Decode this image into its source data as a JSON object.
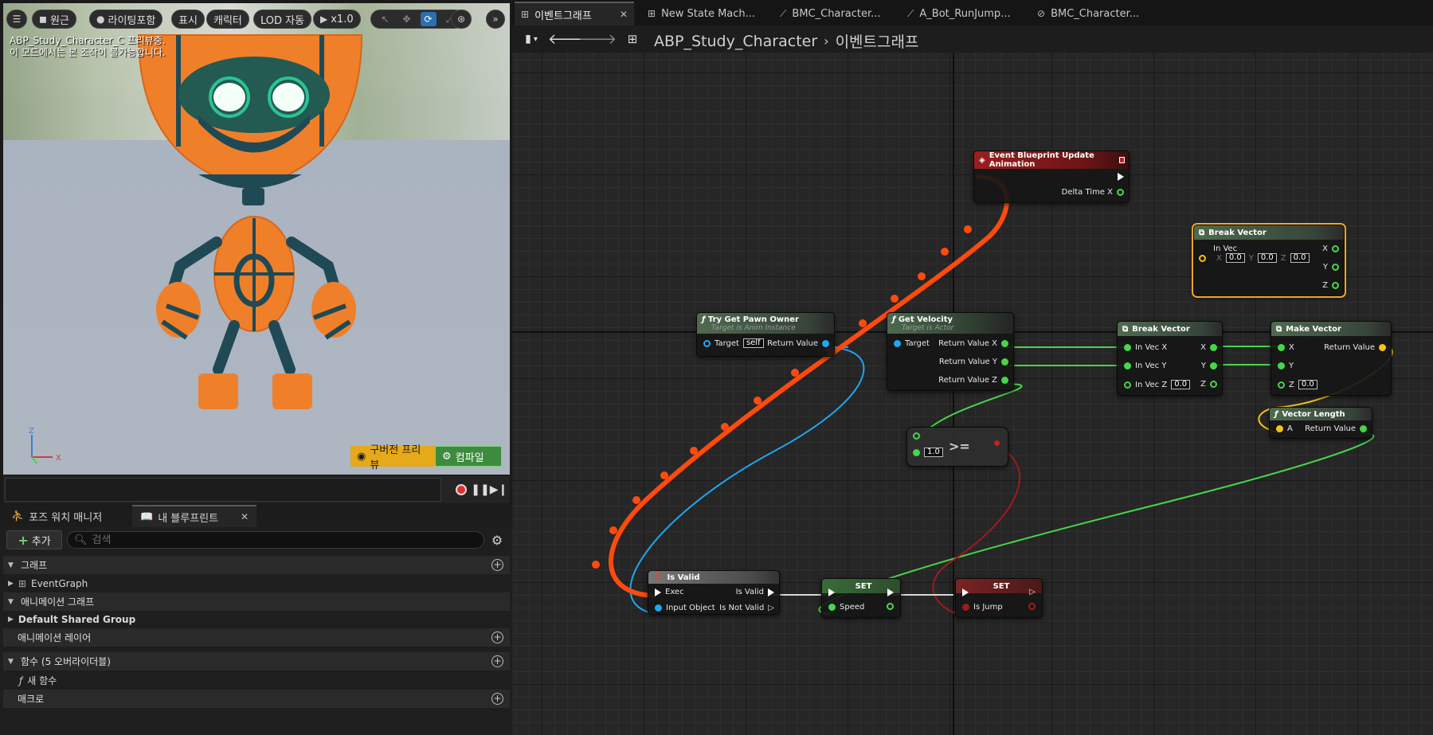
{
  "viewport": {
    "menu_icon": "hamburger-icon",
    "perspective_label": "원근",
    "lighting_label": "라이팅포함",
    "show_label": "표시",
    "character_label": "캐릭터",
    "lod_label": "LOD 자동",
    "play_speed_label": "x1.0",
    "info_line1": "ABP_Study_Character_C 프리뷰중.",
    "info_line2": "이 모드에서는 본 조작이 불가능합니다.",
    "axis_z": "Z",
    "axis_x": "X",
    "preview_button": "구버전 프리뷰",
    "compile_button": "컴파일",
    "colors": {
      "preview": "#e6a91a",
      "compile": "#3d8c3d"
    }
  },
  "left_panel": {
    "tab_pose": "포즈 워치 매니저",
    "tab_blueprint": "내 블루프린트",
    "add_label": "추가",
    "search_placeholder": "검색",
    "sections": {
      "graph": "그래프",
      "graph_item": "EventGraph",
      "anim_graph": "애니메이션 그래프",
      "anim_group": "Default Shared Group",
      "anim_layer": "애니메이션 레이어",
      "functions": "함수 (5 오버라이더블)",
      "new_function": "새 함수",
      "macro": "매크로"
    }
  },
  "editor": {
    "tabs": [
      {
        "label": "이벤트그래프",
        "icon": "graph-icon",
        "active": true
      },
      {
        "label": "New State Mach...",
        "icon": "state-machine-icon"
      },
      {
        "label": "BMC_Character...",
        "icon": "blend-icon"
      },
      {
        "label": "A_Bot_RunJump...",
        "icon": "blend-icon"
      },
      {
        "label": "BMC_Character...",
        "icon": "blend-space-icon"
      }
    ],
    "breadcrumb": {
      "asset": "ABP_Study_Character",
      "graph": "이벤트그래프"
    }
  },
  "nodes": {
    "event_update": {
      "title": "Event Blueprint Update Animation",
      "pin_delta": "Delta Time X"
    },
    "break_vector_sel": {
      "title": "Break Vector",
      "in_vec": "In Vec",
      "x_label": "X",
      "y_label": "Y",
      "z_label": "Z",
      "x": "0.0",
      "y": "0.0",
      "z": "0.0"
    },
    "try_get_pawn": {
      "title": "Try Get Pawn Owner",
      "subtitle": "Target is Anim Instance",
      "target": "Target",
      "target_val": "self",
      "ret": "Return Value"
    },
    "get_velocity": {
      "title": "Get Velocity",
      "subtitle": "Target is Actor",
      "target": "Target",
      "rx": "Return Value X",
      "ry": "Return Value Y",
      "rz": "Return Value Z"
    },
    "break_vector": {
      "title": "Break Vector",
      "in_x": "In Vec X",
      "in_y": "In Vec Y",
      "in_z": "In Vec Z",
      "in_z_val": "0.0",
      "x": "X",
      "y": "Y",
      "z": "Z"
    },
    "make_vector": {
      "title": "Make Vector",
      "x": "X",
      "y": "Y",
      "z": "Z",
      "z_val": "0.0",
      "ret": "Return Value"
    },
    "vector_length": {
      "title": "Vector Length",
      "a": "A",
      "ret": "Return Value"
    },
    "compare": {
      "op": ">=",
      "val": "1.0"
    },
    "is_valid": {
      "title": "Is Valid",
      "exec": "Exec",
      "input": "Input Object",
      "valid": "Is Valid",
      "not_valid": "Is Not Valid"
    },
    "set_speed": {
      "title": "SET",
      "pin": "Speed"
    },
    "set_jump": {
      "title": "SET",
      "pin": "Is Jump"
    }
  },
  "colors": {
    "exec_wire": "#ff4a0e",
    "object_pin": "#1ea7f0",
    "float_pin": "#47d64a",
    "vector_pin": "#f5c21a",
    "bool_pin": "#9e1b1b"
  }
}
